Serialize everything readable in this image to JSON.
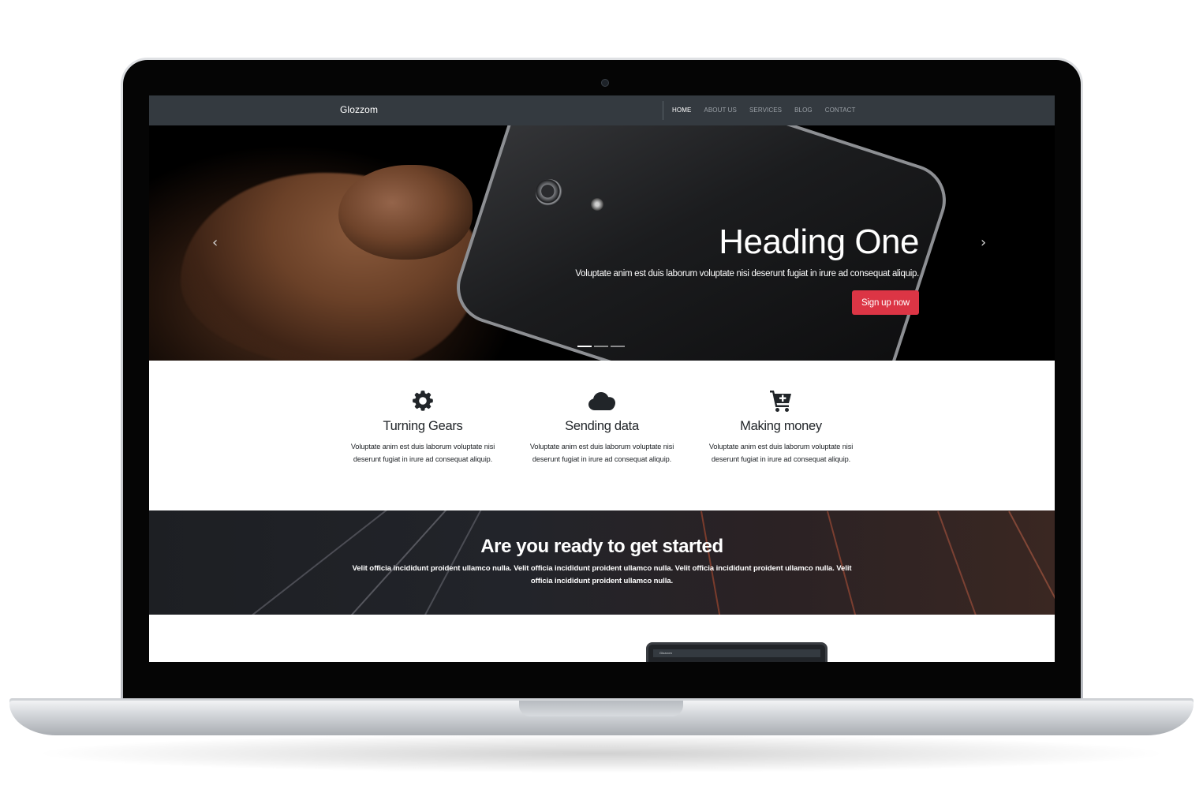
{
  "navbar": {
    "brand": "Glozzom",
    "links": [
      {
        "label": "HOME",
        "active": true
      },
      {
        "label": "ABOUT US",
        "active": false
      },
      {
        "label": "SERVICES",
        "active": false
      },
      {
        "label": "BLOG",
        "active": false
      },
      {
        "label": "CONTACT",
        "active": false
      }
    ]
  },
  "hero": {
    "title": "Heading One",
    "text": "Voluptate anim est duis laborum voluptate nisi deserunt fugiat in irure ad consequat aliquip.",
    "button": "Sign up now",
    "prev_icon": "chevron-left-icon",
    "next_icon": "chevron-right-icon",
    "prev_glyph": "‹",
    "next_glyph": "›",
    "slide_count": 3,
    "active_slide": 1
  },
  "features": [
    {
      "icon": "gear-icon",
      "title": "Turning Gears",
      "text": "Voluptate anim est duis laborum voluptate nisi deserunt fugiat in irure ad consequat aliquip."
    },
    {
      "icon": "cloud-icon",
      "title": "Sending data",
      "text": "Voluptate anim est duis laborum voluptate nisi deserunt fugiat in irure ad consequat aliquip."
    },
    {
      "icon": "cart-plus-icon",
      "title": "Making money",
      "text": "Voluptate anim est duis laborum voluptate nisi deserunt fugiat in irure ad consequat aliquip."
    }
  ],
  "cta": {
    "title": "Are you ready to get started",
    "text": "Velit officia incididunt proident ullamco nulla. Velit officia incididunt proident ullamco nulla. Velit officia incididunt proident ullamco nulla. Velit officia incididunt proident ullamco nulla."
  },
  "preview": {
    "brand": "Glozzom"
  },
  "colors": {
    "navbar": "#343a40",
    "button": "#dc3545",
    "text": "#212529"
  }
}
